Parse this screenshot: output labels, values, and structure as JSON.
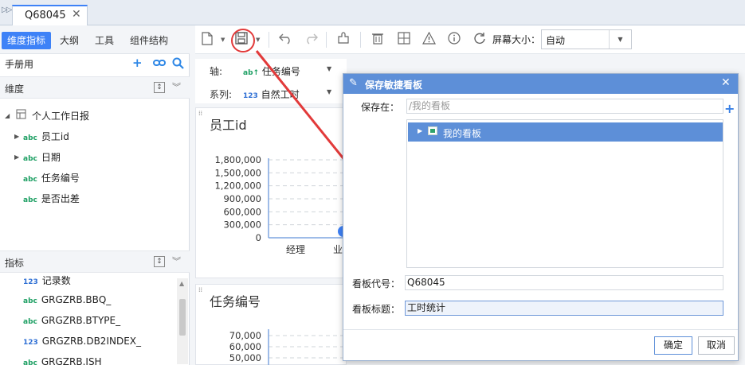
{
  "tabstrip": {
    "tab_title": "Q68045",
    "close_glyph": "✕",
    "collapse_glyph": "▷▷"
  },
  "left": {
    "tabs": [
      "维度指标",
      "大纲",
      "工具",
      "组件结构"
    ],
    "manual_label": "手册用",
    "dimension_section": "维度",
    "dimension_tree": {
      "root": "个人工作日报",
      "items": [
        {
          "type": "abc",
          "label": "员工id",
          "expandable": true
        },
        {
          "type": "abc",
          "label": "日期",
          "expandable": true
        },
        {
          "type": "abc",
          "label": "任务编号",
          "expandable": false
        },
        {
          "type": "abc",
          "label": "是否出差",
          "expandable": false
        }
      ]
    },
    "measure_section": "指标",
    "measures": [
      {
        "type": "123",
        "label": "记录数"
      },
      {
        "type": "abc",
        "label": "GRGZRB.BBQ_"
      },
      {
        "type": "abc",
        "label": "GRGZRB.BTYPE_"
      },
      {
        "type": "123",
        "label": "GRGZRB.DB2INDEX_"
      },
      {
        "type": "abc",
        "label": "GRGZRB.ISH"
      }
    ],
    "type_labels": {
      "abc": "abc",
      "123": "123"
    }
  },
  "toolbar": {
    "screen_size_label": "屏幕大小：",
    "screen_size_value": "自动"
  },
  "axis_bar": {
    "axis_label": "轴:",
    "axis_value": "任务编号",
    "axis_type": "ab↑",
    "series_label": "系列:",
    "series_value": "自然工时",
    "series_type": "123"
  },
  "chart1": {
    "title": "员工id",
    "chart_data": {
      "type": "bar",
      "title": "员工id",
      "categories": [
        "经理",
        "业"
      ],
      "y_ticks": [
        "1,800,000",
        "1,500,000",
        "1,200,000",
        "900,000",
        "600,000",
        "300,000",
        "0"
      ],
      "ylim": [
        0,
        1800000
      ]
    }
  },
  "chart2": {
    "title": "任务编号",
    "chart_data": {
      "type": "bar",
      "title": "任务编号",
      "y_ticks": [
        "70,000",
        "60,000",
        "50,000"
      ]
    }
  },
  "dialog": {
    "title": "保存敏捷看板",
    "close_glyph": "✕",
    "save_in_label": "保存在：",
    "save_in_placeholder": "/我的看板",
    "tree_selected": "我的看板",
    "code_label": "看板代号：",
    "code_value": "Q68045",
    "title_label": "看板标题：",
    "title_value": "工时统计",
    "ok_label": "确定",
    "cancel_label": "取消"
  },
  "colors": {
    "accent": "#3e82f7",
    "dialog_header": "#5d8fd8",
    "annotation": "#e23a3a",
    "type_abc": "#1d9f63",
    "type_123": "#2e6fd4"
  }
}
